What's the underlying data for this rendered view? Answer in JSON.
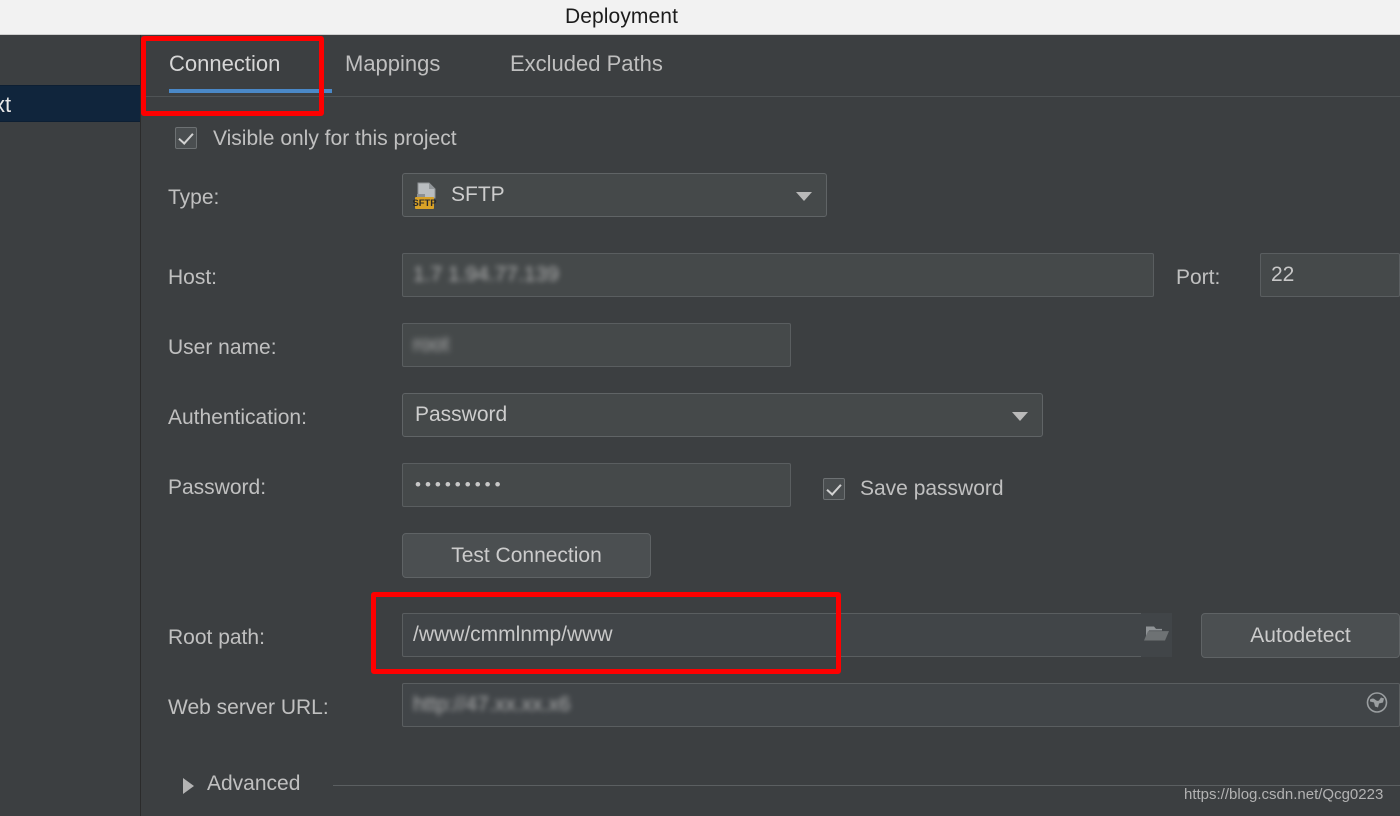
{
  "window": {
    "title": "Deployment"
  },
  "sidebar": {
    "selected_item_label": "xt"
  },
  "tabs": [
    {
      "label": "Connection",
      "active": true
    },
    {
      "label": "Mappings",
      "active": false
    },
    {
      "label": "Excluded Paths",
      "active": false
    }
  ],
  "form": {
    "visible_only_checkbox": {
      "label": "Visible only for this project",
      "checked": true
    },
    "type": {
      "label": "Type:",
      "value": "SFTP",
      "icon": "sftp-file-icon",
      "icon_badge_text": "SFTP",
      "icon_badge_color": "#d9a227"
    },
    "host": {
      "label": "Host:",
      "value": "1.7 1.94.77.139",
      "redacted": true
    },
    "port": {
      "label": "Port:",
      "value": "22"
    },
    "username": {
      "label": "User name:",
      "value": "root",
      "redacted": true
    },
    "authentication": {
      "label": "Authentication:",
      "value": "Password"
    },
    "password": {
      "label": "Password:",
      "value": "•••••••••",
      "save_password": {
        "label": "Save password",
        "checked": true
      }
    },
    "test_connection_button": "Test Connection",
    "root_path": {
      "label": "Root path:",
      "value": "/www/cmmlnmp/www",
      "browse_icon": "folder-icon",
      "autodetect_button": "Autodetect"
    },
    "web_server_url": {
      "label": "Web server URL:",
      "value": "http://47.xx.xx.x6",
      "redacted": true,
      "open_icon": "globe-icon"
    },
    "advanced": {
      "label": "Advanced",
      "expanded": false
    }
  },
  "annotations": {
    "accent_color": "#fe0000",
    "tab_underline_color": "#4a88c7",
    "highlighted": [
      "connection-tab",
      "root-path-field"
    ]
  },
  "watermark": {
    "text": "https://blog.csdn.net/Qcg0223"
  }
}
